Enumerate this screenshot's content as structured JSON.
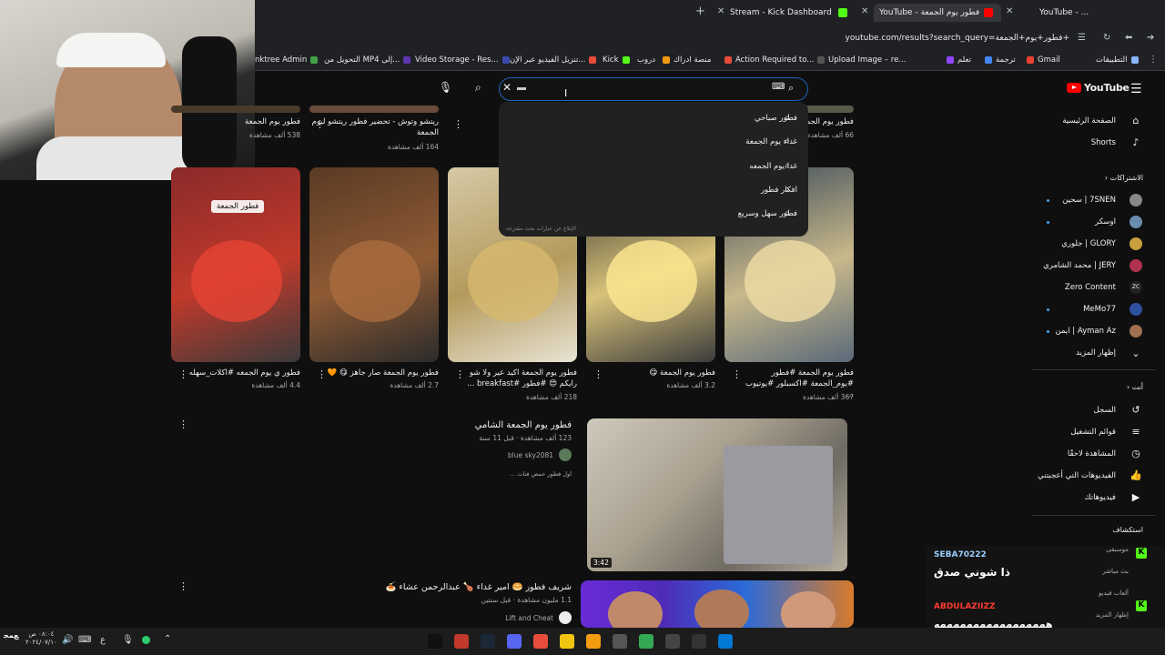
{
  "browser": {
    "tabs": [
      {
        "title": "YouTube - ...",
        "active": false
      },
      {
        "title": "YouTube - فطور يوم الجمعة",
        "active": true
      },
      {
        "title": "Stream - Kick Dashboard",
        "active": false
      }
    ],
    "new_tab": "+",
    "url": "youtube.com/results?search_query=فطور+يوم+الجمعة+",
    "bookmarks": [
      {
        "label": "التطبيقات",
        "color": "#8ab4f8"
      },
      {
        "label": "Gmail",
        "color": "#ea4335"
      },
      {
        "label": "ترجمة",
        "color": "#4285f4"
      },
      {
        "label": "تعلم",
        "color": "#9146ff"
      },
      {
        "label": "Upload Image – re...",
        "color": "#555"
      },
      {
        "label": "Action Required to...",
        "color": "#e74c3c"
      },
      {
        "label": "منصة ادراك",
        "color": "#f39c12"
      },
      {
        "label": "دروب",
        "color": "#e91e63"
      },
      {
        "label": "Kick",
        "color": "#53fc18"
      },
      {
        "label": "تنزيل الفيديو عبر الإن...",
        "color": "#e74c3c"
      },
      {
        "label": "Video Storage - Res...",
        "color": "#3949ab"
      },
      {
        "label": "التحويل من MP4 إلى...",
        "color": "#5e35b1"
      },
      {
        "label": "nktree Admin",
        "color": "#43a047"
      }
    ]
  },
  "youtube": {
    "logo": "YouTube",
    "search": {
      "query": "",
      "suggestions": [
        "فطور صباحي",
        "غداء يوم الجمعة",
        "غدا يوم الجمعه",
        "افكار فطور",
        "فطور سهل وسريع"
      ],
      "footer": "الإبلاغ عن عبارات بحث مقترحة"
    },
    "top_row_titles": [
      {
        "title": "فطور يوم الجمعة",
        "meta": "66 ألف مشاهدة"
      },
      {
        "title": "ريتشو وتوش - تحضير فطور ريتشو ليوم الجمعة",
        "meta": "164 ألف مشاهدة"
      },
      {
        "title": "فطور يوم الجمعة",
        "meta": "538 ألف مشاهدة"
      }
    ],
    "thumb_overlay_label": "فطور الجمعة",
    "shorts": [
      {
        "title": "فطور ي يوم الجمعه #اكلات_سهله",
        "meta": "4.4 ألف مشاهدة",
        "colors": [
          "#8a2a2a",
          "#c0392b",
          "#3a3a3a"
        ]
      },
      {
        "title": "فطور يوم الجمعة صار جاهز 😋 🧡",
        "meta": "2.7 ألف مشاهدة",
        "colors": [
          "#5a3a24",
          "#8e5a34",
          "#2b2b2b"
        ]
      },
      {
        "title": "فطور يوم الجمعة اكيد عير ولا شو رايكم 😍 #فطور #breakfast ...",
        "meta": "218 ألف مشاهدة",
        "colors": [
          "#d6c9a6",
          "#b49a5c",
          "#e8e3d4"
        ]
      },
      {
        "title": "فطور يوم الجمعة 😋",
        "meta": "3.2 ألف مشاهدة",
        "colors": [
          "#2a2a2a",
          "#d8c27a",
          "#3c3c3c"
        ]
      },
      {
        "title": "فطور يوم الجمعة #فطور #يوم_الجمعة #اكسبلور #يوتيوب ...",
        "meta": "367 ألف مشاهدة",
        "colors": [
          "#3a4a5a",
          "#c8b88a",
          "#5a6a7a"
        ]
      }
    ],
    "video1": {
      "title": "فطور يوم الجمعة الشامي",
      "meta": "123 ألف مشاهدة · قبل 11 سنة",
      "channel": "blue sky2081",
      "desc": "اول فطور حمص فتات ...",
      "duration": "3:42"
    },
    "video2": {
      "title": "شريف فطور 🥯 امير غداء 🍗 عبدالرحمن عشاء 🍝",
      "meta": "1.1 مليون مشاهدة · قبل سنتين",
      "channel": "Lift and Cheat"
    },
    "sidebar": {
      "home": "الصفحة الرئيسية",
      "shorts": "Shorts",
      "subs_header": "الاشتراكات",
      "subscriptions": [
        {
          "name": "7SNEN | سحين",
          "color": "#888",
          "dot": true
        },
        {
          "name": "اوسكر",
          "color": "#6a8caf",
          "dot": true
        },
        {
          "name": "GLORY | جلوري",
          "color": "#c8a040",
          "dot": false
        },
        {
          "name": "JERY | محمد الشامري",
          "color": "#b03050",
          "dot": false
        },
        {
          "name": "Zero Content",
          "color": "#222",
          "dot": false,
          "mark": "ZC"
        },
        {
          "name": "MeMo77",
          "color": "#3050a0",
          "dot": true
        },
        {
          "name": "Ayman Az | ايمن",
          "color": "#a07050",
          "dot": true
        }
      ],
      "show_more_1": "إظهار المزيد",
      "you_header": "أنت",
      "you_items": [
        "السجل",
        "قوائم التشغيل",
        "المشاهدة لاحقًا",
        "الفيديوهات التي أعجبتني",
        "فيديوهاتك"
      ],
      "explore_header": "استكشاف",
      "explore_items": [
        "موسيقى",
        "بث مباشر",
        "ألعاب فيديو",
        "إظهار المزيد"
      ]
    }
  },
  "chat": {
    "user1": "SEBA70222",
    "msg1": "ذا شوني صدق",
    "user2": "ABDULAZIIZZ",
    "msg2": "هههههههههههههههههه"
  },
  "taskbar": {
    "time": "٠٨:٠٤ ص",
    "date": "٢٠٢٤/٠٧/١٠",
    "lang": "ع"
  }
}
